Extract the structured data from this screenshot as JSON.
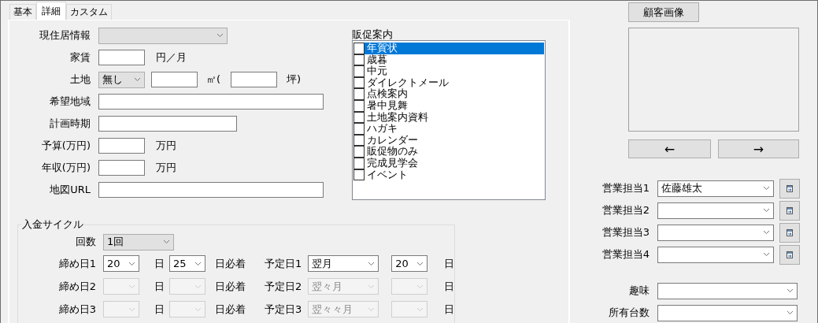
{
  "tabs": [
    {
      "label": "基本",
      "selected": false
    },
    {
      "label": "詳細",
      "selected": true
    },
    {
      "label": "カスタム",
      "selected": false
    }
  ],
  "details": [
    {
      "kind": "combo",
      "label": "現住居情報",
      "combo": {
        "kind": "list",
        "disabled": false
      }
    },
    {
      "kind": "amount",
      "label": "家賃",
      "unit": "円／月"
    },
    {
      "kind": "land",
      "label": "土地",
      "combo": {
        "kind": "list",
        "disabled": false,
        "value": "無し"
      },
      "unit": "㎡(",
      "unit2": "坪)"
    },
    {
      "kind": "long_text",
      "label": "希望地域"
    },
    {
      "kind": "medium_text",
      "label": "計画時期"
    },
    {
      "kind": "amount",
      "label": "予算(万円)",
      "unit": "万円"
    },
    {
      "kind": "amount",
      "label": "年収(万円)",
      "unit": "万円"
    },
    {
      "kind": "long_text",
      "label": "地図URL"
    }
  ],
  "promotion": {
    "label": "販促案内",
    "items": [
      {
        "label": "年賀状",
        "checked": false,
        "selected": true
      },
      {
        "label": "歳暮",
        "checked": false,
        "selected": false
      },
      {
        "label": "中元",
        "checked": false,
        "selected": false
      },
      {
        "label": "ダイレクトメール",
        "checked": false,
        "selected": false
      },
      {
        "label": "点検案内",
        "checked": false,
        "selected": false
      },
      {
        "label": "暑中見舞",
        "checked": false,
        "selected": false
      },
      {
        "label": "土地案内資料",
        "checked": false,
        "selected": false
      },
      {
        "label": "ハガキ",
        "checked": false,
        "selected": false
      },
      {
        "label": "カレンダー",
        "checked": false,
        "selected": false
      },
      {
        "label": "販促物のみ",
        "checked": false,
        "selected": false
      },
      {
        "label": "完成見学会",
        "checked": false,
        "selected": false
      },
      {
        "label": "イベント",
        "checked": false,
        "selected": false
      }
    ]
  },
  "payment_cycle": {
    "title": "入金サイクル",
    "count": {
      "label": "回数",
      "combo": {
        "kind": "list",
        "disabled": false,
        "value": "1回"
      }
    },
    "rows": [
      {
        "label": "締め日1",
        "closing_day": {
          "kind": "edit",
          "disabled": false,
          "value": "20"
        },
        "day_unit": "日",
        "arrival_day": {
          "kind": "edit",
          "disabled": false,
          "value": "25"
        },
        "arrival_unit": "日必着",
        "schedule_label": "予定日1",
        "schedule_month": {
          "kind": "edit",
          "disabled": false,
          "value": "翌月"
        },
        "schedule_day": {
          "kind": "edit",
          "disabled": false,
          "value": "20"
        },
        "schedule_unit": "日"
      },
      {
        "label": "締め日2",
        "closing_day": {
          "kind": "edit",
          "disabled": true
        },
        "day_unit": "日",
        "arrival_day": {
          "kind": "edit",
          "disabled": true
        },
        "arrival_unit": "日必着",
        "schedule_label": "予定日2",
        "schedule_month": {
          "kind": "edit",
          "disabled": true,
          "value": "翌々月"
        },
        "schedule_day": {
          "kind": "edit",
          "disabled": true
        },
        "schedule_unit": "日"
      },
      {
        "label": "締め日3",
        "closing_day": {
          "kind": "edit",
          "disabled": true
        },
        "day_unit": "日",
        "arrival_day": {
          "kind": "edit",
          "disabled": true
        },
        "arrival_unit": "日必着",
        "schedule_label": "予定日3",
        "schedule_month": {
          "kind": "edit",
          "disabled": true,
          "value": "翌々々月"
        },
        "schedule_day": {
          "kind": "edit",
          "disabled": true
        },
        "schedule_unit": "日"
      }
    ]
  },
  "customer_image": {
    "button": "顧客画像",
    "prev": "←",
    "next": "→"
  },
  "sales_reps": [
    {
      "label": "営業担当1",
      "combo": {
        "kind": "edit",
        "disabled": false,
        "value": "佐藤雄太"
      }
    },
    {
      "label": "営業担当2",
      "combo": {
        "kind": "edit",
        "disabled": false
      }
    },
    {
      "label": "営業担当3",
      "combo": {
        "kind": "edit",
        "disabled": false
      }
    },
    {
      "label": "営業担当4",
      "combo": {
        "kind": "edit",
        "disabled": false
      }
    }
  ],
  "extra": [
    {
      "label": "趣味",
      "combo": {
        "kind": "edit",
        "disabled": false
      }
    },
    {
      "label": "所有台数",
      "combo": {
        "kind": "edit",
        "disabled": false
      }
    }
  ]
}
